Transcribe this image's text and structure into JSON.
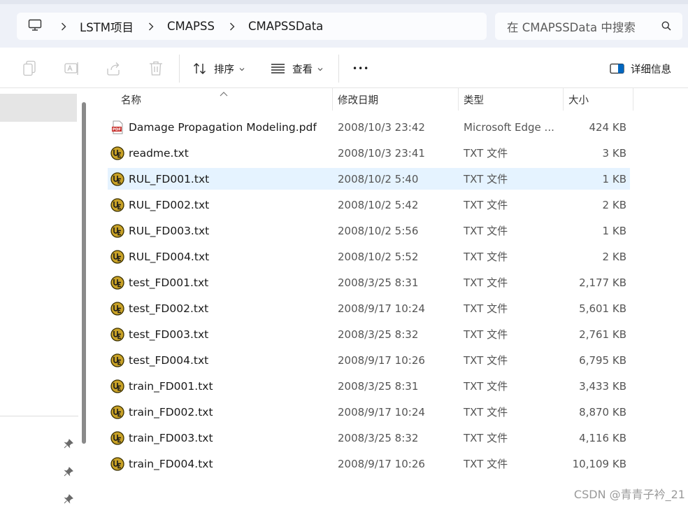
{
  "breadcrumb": {
    "items": [
      "LSTM项目",
      "CMAPSS",
      "CMAPSSData"
    ]
  },
  "search": {
    "placeholder": "在 CMAPSSData 中搜索"
  },
  "toolbar": {
    "sort_label": "排序",
    "view_label": "查看",
    "more_label": "•••",
    "details_label": "详细信息"
  },
  "columns": {
    "name": "名称",
    "date": "修改日期",
    "type": "类型",
    "size": "大小"
  },
  "files": [
    {
      "name": "Damage Propagation Modeling.pdf",
      "date": "2008/10/3 23:42",
      "type": "Microsoft Edge ...",
      "size": "424 KB",
      "icon": "pdf-file-icon",
      "selected": false
    },
    {
      "name": "readme.txt",
      "date": "2008/10/3 23:41",
      "type": "TXT 文件",
      "size": "3 KB",
      "icon": "ultraedit-file-icon",
      "selected": false
    },
    {
      "name": "RUL_FD001.txt",
      "date": "2008/10/2 5:40",
      "type": "TXT 文件",
      "size": "1 KB",
      "icon": "ultraedit-file-icon",
      "selected": true
    },
    {
      "name": "RUL_FD002.txt",
      "date": "2008/10/2 5:42",
      "type": "TXT 文件",
      "size": "2 KB",
      "icon": "ultraedit-file-icon",
      "selected": false
    },
    {
      "name": "RUL_FD003.txt",
      "date": "2008/10/2 5:56",
      "type": "TXT 文件",
      "size": "1 KB",
      "icon": "ultraedit-file-icon",
      "selected": false
    },
    {
      "name": "RUL_FD004.txt",
      "date": "2008/10/2 5:52",
      "type": "TXT 文件",
      "size": "2 KB",
      "icon": "ultraedit-file-icon",
      "selected": false
    },
    {
      "name": "test_FD001.txt",
      "date": "2008/3/25 8:31",
      "type": "TXT 文件",
      "size": "2,177 KB",
      "icon": "ultraedit-file-icon",
      "selected": false
    },
    {
      "name": "test_FD002.txt",
      "date": "2008/9/17 10:24",
      "type": "TXT 文件",
      "size": "5,601 KB",
      "icon": "ultraedit-file-icon",
      "selected": false
    },
    {
      "name": "test_FD003.txt",
      "date": "2008/3/25 8:32",
      "type": "TXT 文件",
      "size": "2,761 KB",
      "icon": "ultraedit-file-icon",
      "selected": false
    },
    {
      "name": "test_FD004.txt",
      "date": "2008/9/17 10:26",
      "type": "TXT 文件",
      "size": "6,795 KB",
      "icon": "ultraedit-file-icon",
      "selected": false
    },
    {
      "name": "train_FD001.txt",
      "date": "2008/3/25 8:31",
      "type": "TXT 文件",
      "size": "3,433 KB",
      "icon": "ultraedit-file-icon",
      "selected": false
    },
    {
      "name": "train_FD002.txt",
      "date": "2008/9/17 10:24",
      "type": "TXT 文件",
      "size": "8,870 KB",
      "icon": "ultraedit-file-icon",
      "selected": false
    },
    {
      "name": "train_FD003.txt",
      "date": "2008/3/25 8:32",
      "type": "TXT 文件",
      "size": "4,116 KB",
      "icon": "ultraedit-file-icon",
      "selected": false
    },
    {
      "name": "train_FD004.txt",
      "date": "2008/9/17 10:26",
      "type": "TXT 文件",
      "size": "10,109 KB",
      "icon": "ultraedit-file-icon",
      "selected": false
    }
  ],
  "watermark": "CSDN @青青子衿_21",
  "colors": {
    "selection": "#e5f3ff",
    "accent": "#0067c0",
    "pdf_red": "#c8312d",
    "ue_gold": "#c9a227"
  }
}
